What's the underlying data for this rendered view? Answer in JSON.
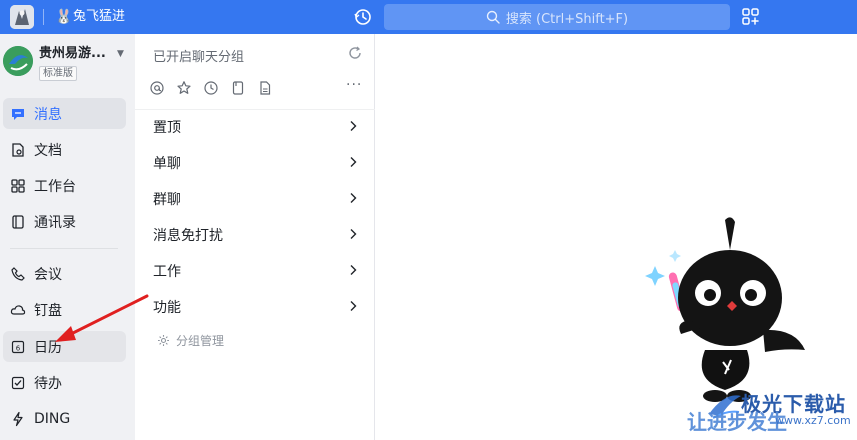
{
  "topbar": {
    "status_text": "兔飞猛进",
    "search_placeholder": "搜索 (Ctrl+Shift+F)",
    "brand_color": "#3577f0"
  },
  "org": {
    "name": "贵州易游...",
    "badge": "标准版"
  },
  "nav": {
    "items": [
      {
        "label": "消息",
        "icon": "message-icon",
        "active": true
      },
      {
        "label": "文档",
        "icon": "document-icon"
      },
      {
        "label": "工作台",
        "icon": "workbench-icon"
      },
      {
        "label": "通讯录",
        "icon": "contacts-icon"
      },
      {
        "label": "会议",
        "icon": "meeting-icon"
      },
      {
        "label": "钉盘",
        "icon": "cloud-drive-icon"
      },
      {
        "label": "日历",
        "icon": "calendar-icon",
        "calendar_day": "6"
      },
      {
        "label": "待办",
        "icon": "todo-icon"
      },
      {
        "label": "DING",
        "icon": "ding-icon"
      }
    ]
  },
  "midpanel": {
    "header": "已开启聊天分组",
    "icons": [
      "at-icon",
      "star-icon",
      "clock-icon",
      "bookmark-icon",
      "file-icon"
    ],
    "groups": [
      "置顶",
      "单聊",
      "群聊",
      "消息免打扰",
      "工作",
      "功能"
    ],
    "manage_label": "分组管理"
  },
  "watermark": {
    "site": "极光下载站",
    "slogan": "让进步发生",
    "url": "www.xz7.com"
  },
  "colors": {
    "accent": "#3370ff",
    "annotation_arrow": "#e02020"
  }
}
